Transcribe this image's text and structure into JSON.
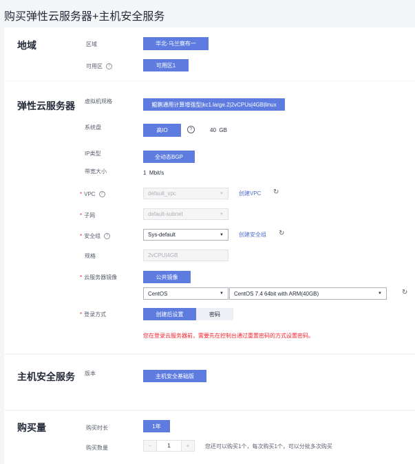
{
  "page_title": "购买弹性云服务器+主机安全服务",
  "region_section": {
    "title": "地域",
    "region_label": "区域",
    "region_value": "华北-乌兰察布一",
    "az_label": "可用区",
    "az_value": "可用区1"
  },
  "ecs_section": {
    "title": "弹性云服务器",
    "flavor_label": "虚拟机规格",
    "flavor_value": "鲲鹏通用计算增强型|kc1.large.2|2vCPUs|4GB|linux",
    "disk_label": "系统盘",
    "disk_type": "高IO",
    "disk_size": "40",
    "disk_unit": "GB",
    "ip_label": "IP类型",
    "ip_value": "全动态BGP",
    "bandwidth_label": "带宽大小",
    "bandwidth_value": "1",
    "bandwidth_unit": "Mbit/s",
    "vpc_label": "VPC",
    "vpc_value": "default_vpc",
    "vpc_create": "创建VPC",
    "subnet_label": "子网",
    "subnet_value": "default-subnet",
    "sg_label": "安全组",
    "sg_value": "Sys-default",
    "sg_create": "创建安全组",
    "spec_label": "规格",
    "spec_value": "2vCPU|4GB",
    "image_label": "云服务器镜像",
    "image_type": "公共镜像",
    "os_value": "CentOS",
    "os_version": "CentOS 7.4 64bit with ARM(40GB)",
    "login_label": "登录方式",
    "login_option_active": "创建后设置",
    "login_option_other": "密码",
    "login_tip": "您在登录云服务器前，需要先在控制台通过重置密码的方式设置密码。"
  },
  "hss_section": {
    "title": "主机安全服务",
    "version_label": "版本",
    "version_value": "主机安全基础版"
  },
  "purchase_section": {
    "title": "购买量",
    "duration_label": "购买时长",
    "duration_value": "1年",
    "quantity_label": "购买数量",
    "quantity_value": "1",
    "quantity_minus": "−",
    "quantity_plus": "+",
    "quantity_hint": "您还可以购买1个，每次购买1个，可以分批多次购买"
  },
  "icons": {
    "help": "?",
    "refresh": "↻",
    "caret": "▼",
    "required": "*"
  },
  "colors": {
    "primary": "#5e7ce0",
    "link": "#526ecc",
    "error": "#f5222d"
  }
}
